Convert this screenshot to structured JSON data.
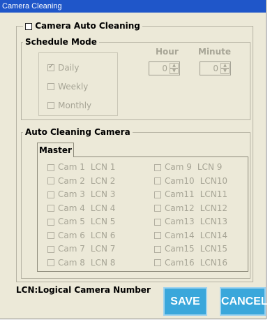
{
  "window": {
    "title": "Camera Cleaning"
  },
  "auto_cleaning": {
    "label": "Camera Auto Cleaning",
    "checked": false
  },
  "schedule": {
    "legend": "Schedule Mode",
    "hour_label": "Hour",
    "minute_label": "Minute",
    "hour_value": "0",
    "minute_value": "0",
    "options": [
      {
        "label": "Daily",
        "checked": true
      },
      {
        "label": "Weekly",
        "checked": false
      },
      {
        "label": "Monthly",
        "checked": false
      }
    ]
  },
  "camera_group": {
    "legend": "Auto Cleaning Camera",
    "tab_label": "Master",
    "cameras": [
      {
        "cam": "Cam 1",
        "lcn": "LCN 1"
      },
      {
        "cam": "Cam 2",
        "lcn": "LCN 2"
      },
      {
        "cam": "Cam 3",
        "lcn": "LCN 3"
      },
      {
        "cam": "Cam 4",
        "lcn": "LCN 4"
      },
      {
        "cam": "Cam 5",
        "lcn": "LCN 5"
      },
      {
        "cam": "Cam 6",
        "lcn": "LCN 6"
      },
      {
        "cam": "Cam 7",
        "lcn": "LCN 7"
      },
      {
        "cam": "Cam 8",
        "lcn": "LCN 8"
      },
      {
        "cam": "Cam 9",
        "lcn": "LCN 9"
      },
      {
        "cam": "Cam10",
        "lcn": "LCN10"
      },
      {
        "cam": "Cam11",
        "lcn": "LCN11"
      },
      {
        "cam": "Cam12",
        "lcn": "LCN12"
      },
      {
        "cam": "Cam13",
        "lcn": "LCN13"
      },
      {
        "cam": "Cam14",
        "lcn": "LCN14"
      },
      {
        "cam": "Cam15",
        "lcn": "LCN15"
      },
      {
        "cam": "Cam16",
        "lcn": "LCN16"
      }
    ]
  },
  "footer": {
    "note": "LCN:Logical Camera Number",
    "save_label": "SAVE",
    "cancel_label": "CANCEL"
  },
  "colors": {
    "title_bar": "#1f56c9",
    "button": "#3aa7db",
    "disabled_text": "#a7a596"
  }
}
